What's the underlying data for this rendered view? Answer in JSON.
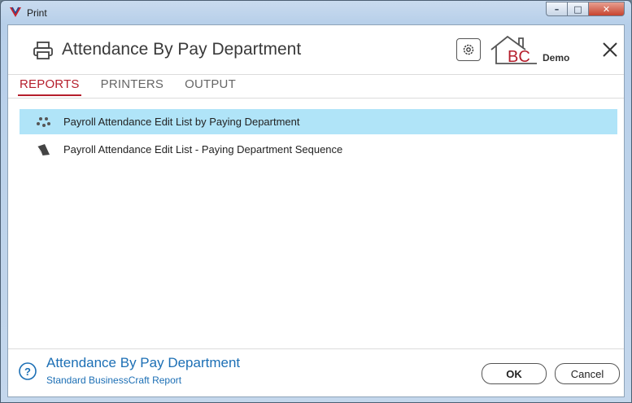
{
  "window": {
    "title": "Print",
    "controls": {
      "minimize": "–",
      "maximize": "□",
      "close": "✕"
    }
  },
  "header": {
    "title": "Attendance By Pay Department",
    "logo_text": "BC",
    "logo_caption": "Demo",
    "icons": [
      "printer-icon",
      "gear-icon",
      "bc-logo",
      "close-icon"
    ]
  },
  "tabs": [
    {
      "label": "REPORTS",
      "active": true
    },
    {
      "label": "PRINTERS",
      "active": false
    },
    {
      "label": "OUTPUT",
      "active": false
    }
  ],
  "reports": [
    {
      "label": "Payroll Attendance Edit List by Paying Department",
      "icon": "dots-icon",
      "selected": true
    },
    {
      "label": "Payroll Attendance Edit List - Paying Department Sequence",
      "icon": "ribbon-icon",
      "selected": false
    }
  ],
  "footer": {
    "title": "Attendance By Pay Department",
    "subtitle": "Standard BusinessCraft Report",
    "ok_label": "OK",
    "cancel_label": "Cancel"
  },
  "colors": {
    "accent_red": "#b51e2c",
    "selection": "#b0e4f8",
    "footer_blue": "#1c6fb5"
  }
}
